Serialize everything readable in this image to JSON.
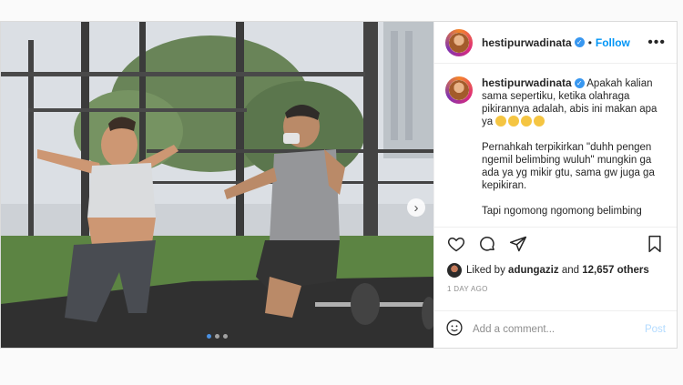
{
  "post": {
    "username": "hestipurwadinata",
    "follow_label": "Follow",
    "separator": "•",
    "more_label": "•••",
    "next_label": "›",
    "caption_prefix": "Apakah kalian sama sepertiku, ketika olahraga pikirannya adalah, abis ini makan apa ya",
    "caption_p2": "Pernahkah terpikirkan \"duhh pengen ngemil belimbing wuluh\" mungkin ga ada ya yg mikir gtu, sama gw juga ga kepikiran.",
    "caption_p3": "Tapi ngomong ngomong belimbing",
    "likes_prefix": "Liked by",
    "liker": "adungaziz",
    "likes_and": "and",
    "likes_count": "12,657 others",
    "time_ago": "1 DAY AGO",
    "comment_placeholder": "Add a comment...",
    "post_label": "Post",
    "carousel_active_index": 0,
    "carousel_count": 3
  },
  "colors": {
    "accent": "#0095f6",
    "verified": "#3897f0",
    "post_disabled": "#b3dbff"
  }
}
